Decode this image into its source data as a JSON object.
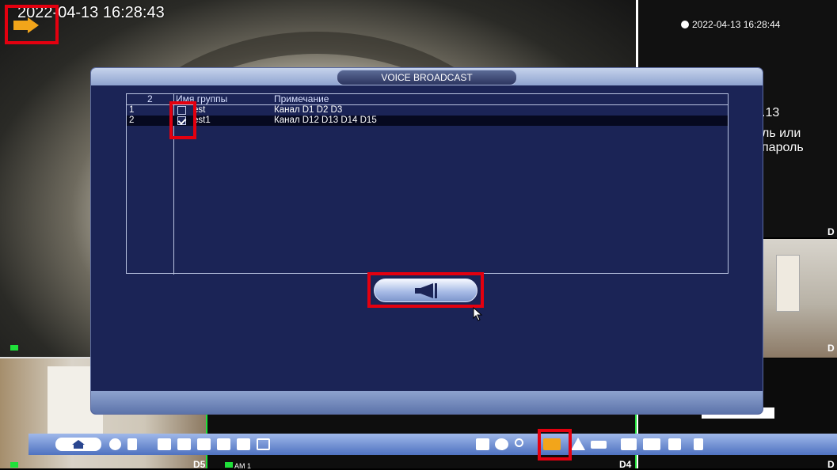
{
  "osd": {
    "main_timestamp": "2022-04-13 16:28:43",
    "tr_timestamp": "2022-04-13 16:28:44",
    "tr_text_a": ".13",
    "tr_text_b": "ль или пароль"
  },
  "dialog": {
    "title": "VOICE BROADCAST",
    "table": {
      "count_header": "2",
      "columns": [
        "Имя группы",
        "Примечание"
      ],
      "rows": [
        {
          "index": "1",
          "checked": false,
          "name": "est",
          "note": "Канал  D1  D2  D3"
        },
        {
          "index": "2",
          "checked": true,
          "name": "est1",
          "note": "Канал  D12  D13  D14  D15"
        }
      ]
    },
    "broadcast_button_icon": "megaphone-icon"
  },
  "channels": {
    "d5": "D5",
    "am": "AM 1",
    "d4": "D4",
    "d_right1": "D",
    "d_right2": "D",
    "d_right3": "D"
  },
  "taskbar": {
    "icons": [
      "home-icon",
      "back-icon",
      "lock-icon",
      "layout-1-icon",
      "layout-4-icon",
      "layout-6-icon",
      "layout-8-icon",
      "layout-9-icon",
      "layout-16-icon",
      "ptz-icon",
      "color-icon",
      "search-icon",
      "voice-broadcast-icon",
      "alarm-icon",
      "camera-icon",
      "network-icon",
      "settings-icon",
      "disk-icon",
      "shutdown-icon"
    ]
  },
  "colors": {
    "highlight": "#e4000f",
    "dialog_bg": "#1b2456",
    "accent_green": "#1fe03a"
  }
}
